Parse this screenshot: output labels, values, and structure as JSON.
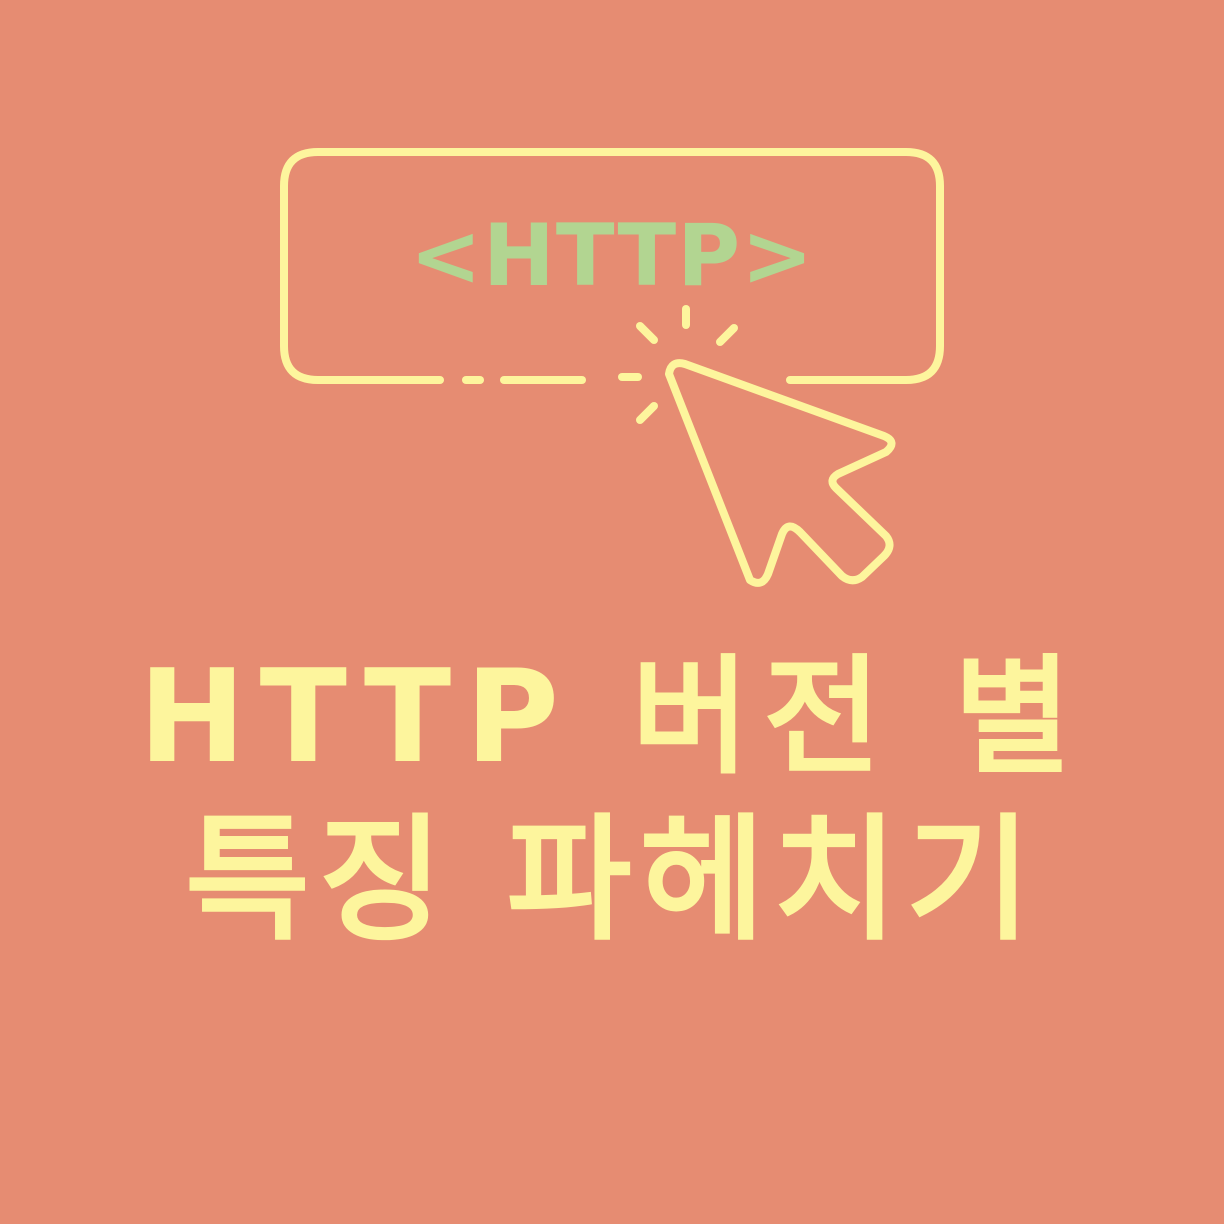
{
  "colors": {
    "background": "#e68c72",
    "accent_yellow": "#fdf59d",
    "accent_green": "#b2d591"
  },
  "button": {
    "label": "<HTTP>"
  },
  "headline": {
    "line1": "HTTP 버전 별",
    "line2": "특징 파헤치기"
  },
  "icons": [
    "browser-button-icon",
    "mouse-cursor-icon",
    "click-burst-icon"
  ]
}
